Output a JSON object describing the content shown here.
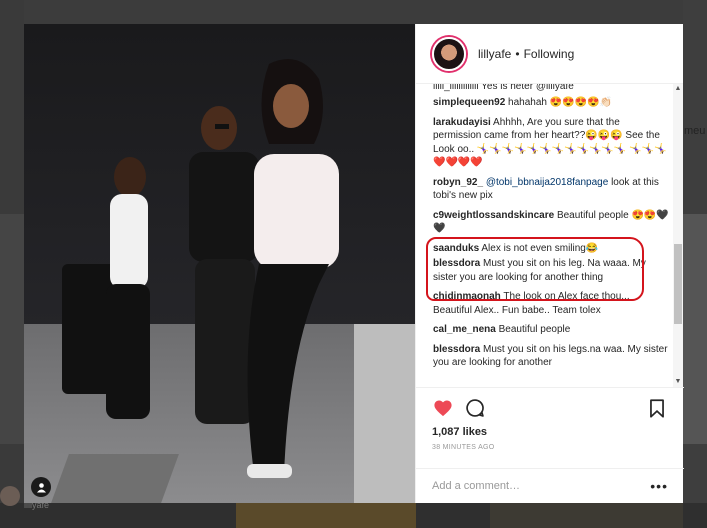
{
  "background": {
    "side_username": "lillyafe",
    "side_text": "meu"
  },
  "post": {
    "username": "lillyafe",
    "follow_status": "Following",
    "cut_comment": "iiiii_iiiiiiiiiiiii Yes is heter @lillyafe",
    "comments": [
      {
        "user": "simplequeen92",
        "text": "hahahah 😍😍😍😍👏🏻"
      },
      {
        "user": "larakudayisi",
        "text": "Ahhhh, Are you sure that the permission came from her heart??😜😜😜 See the Look oo.. 🤸‍♀️🤸‍♀️🤸‍♀️🤸‍♀️🤸‍♀️🤸‍♀️🤸‍♀️🤸‍♀️🤸‍♀️🤸‍♀️🤸‍♀️🤸‍♀️ 🤸‍♀️🤸‍♀️🤸‍♀️ ❤️❤️❤️❤️"
      },
      {
        "user": "robyn_92_",
        "mention": "@tobi_bbnaija2018fanpage",
        "text": "look at this tobi's new pix"
      },
      {
        "user": "c9weightlossandskincare",
        "text": "Beautiful people 😍😍🖤🖤"
      },
      {
        "user": "saanduks",
        "text": "Alex is not even smiling😂"
      },
      {
        "user": "blessdora",
        "text": "Must you sit on his leg. Na waaa. My sister you are looking for another thing"
      },
      {
        "user": "chidinmaonah",
        "text": "The look on Alex face thou... Beautiful Alex.. Fun babe.. Team tolex"
      },
      {
        "user": "cal_me_nena",
        "text": "Beautiful people"
      },
      {
        "user": "blessdora",
        "text": "Must you sit on his legs.na waa. My sister you are looking for another"
      }
    ],
    "likes": "1,087 likes",
    "time": "38 MINUTES AGO",
    "add_comment_placeholder": "Add a comment…",
    "more_label": "•••"
  },
  "colors": {
    "heart": "#ed4956",
    "annotation": "#d4141c"
  },
  "icons": [
    "heart-icon",
    "comment-icon",
    "bookmark-icon",
    "user-tag-icon",
    "more-icon"
  ]
}
